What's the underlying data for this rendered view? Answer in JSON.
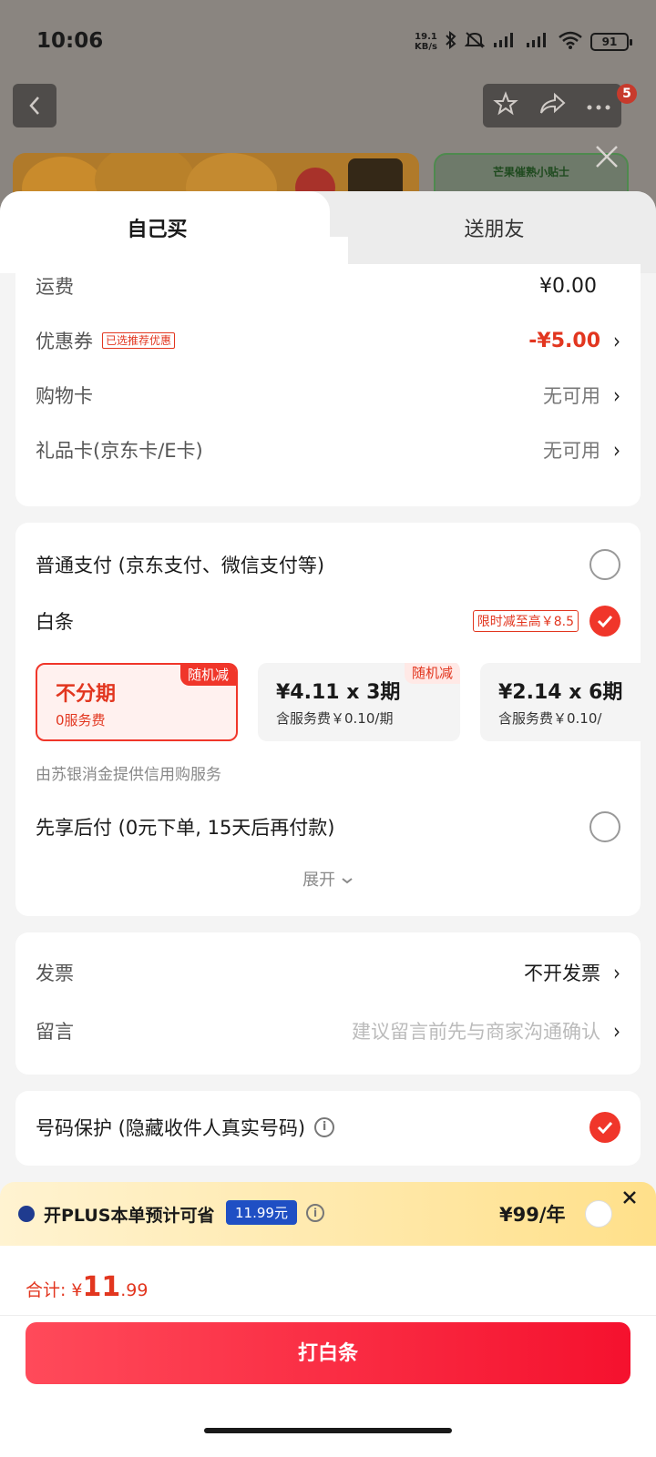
{
  "status": {
    "time": "10:06",
    "net_speed_value": "19.1",
    "net_speed_unit": "KB/s",
    "battery": "91"
  },
  "nav": {
    "badge": "5"
  },
  "tips": {
    "title": "芒果催熟小贴士"
  },
  "tabs": {
    "self": "自己买",
    "friend": "送朋友"
  },
  "costs": {
    "shipping_label": "运费",
    "shipping_value": "¥0.00",
    "coupon_label": "优惠券",
    "coupon_tag": "已选推荐优惠",
    "coupon_value": "-¥5.00",
    "shopping_card_label": "购物卡",
    "shopping_card_value": "无可用",
    "gift_card_label": "礼品卡(京东卡/E卡)",
    "gift_card_value": "无可用"
  },
  "payment": {
    "normal_label": "普通支付 (京东支付、微信支付等)",
    "baitiao_label": "白条",
    "baitiao_promo": "限时减至高￥8.5",
    "plans": [
      {
        "title": "不分期",
        "sub": "0服务费",
        "badge": "随机减",
        "selected": true
      },
      {
        "title": "¥4.11 x 3期",
        "sub": "含服务费￥0.10/期",
        "badge": "随机减",
        "selected": false
      },
      {
        "title": "¥2.14 x 6期",
        "sub": "含服务费￥0.10/",
        "badge": "",
        "selected": false
      }
    ],
    "credit_note": "由苏银消金提供信用购服务",
    "later_label": "先享后付 (0元下单, 15天后再付款)",
    "expand_label": "展开",
    "accent": "#f0362a"
  },
  "invoice": {
    "invoice_label": "发票",
    "invoice_value": "不开发票",
    "message_label": "留言",
    "message_placeholder": "建议留言前先与商家沟通确认"
  },
  "privacy": {
    "label": "号码保护 (隐藏收件人真实号码)"
  },
  "plus": {
    "text": "开PLUS本单预计可省",
    "save": "11.99元",
    "price": "¥99/年"
  },
  "footer": {
    "total_label": "合计:",
    "total_yen": "¥",
    "total_int": "11",
    "total_dec": ".99",
    "pay_button": "打白条"
  }
}
